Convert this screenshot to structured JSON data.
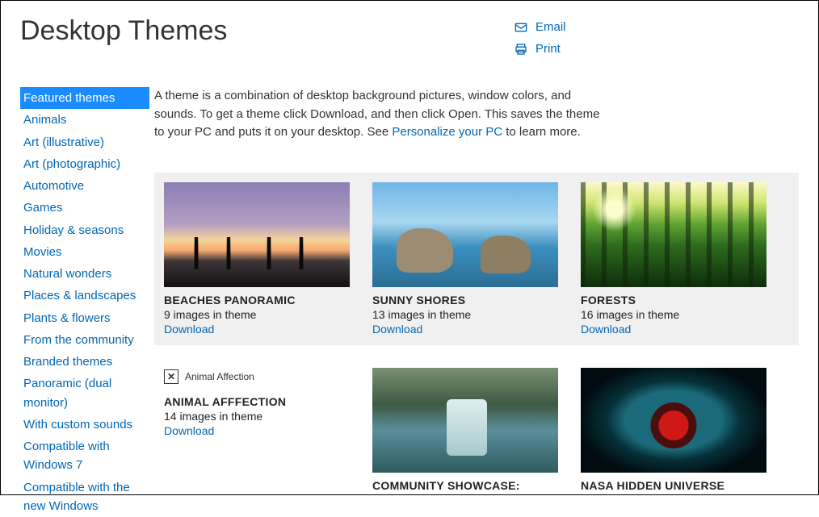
{
  "page_title": "Desktop Themes",
  "share": {
    "email": "Email",
    "print": "Print"
  },
  "intro": {
    "pre": "A theme is a combination of desktop background pictures, window colors, and sounds. To get a theme click Download, and then click Open. This saves the theme to your PC and puts it on your desktop. See ",
    "link": "Personalize your PC",
    "post": " to learn more."
  },
  "sidebar": {
    "items": [
      "Featured themes",
      "Animals",
      "Art (illustrative)",
      "Art (photographic)",
      "Automotive",
      "Games",
      "Holiday & seasons",
      "Movies",
      "Natural wonders",
      "Places & landscapes",
      "Plants & flowers",
      "From the community",
      "Branded themes",
      "Panoramic (dual monitor)",
      "With custom sounds",
      "Compatible with Windows 7",
      "Compatible with the new Windows"
    ],
    "active_index": 0
  },
  "download_label": "Download",
  "row1": [
    {
      "title": "BEACHES PANORAMIC",
      "sub": "9 images in theme"
    },
    {
      "title": "SUNNY SHORES",
      "sub": "13 images in theme"
    },
    {
      "title": "FORESTS",
      "sub": "16 images in theme"
    }
  ],
  "row2": [
    {
      "alt": "Animal Affection",
      "title": "ANIMAL AFFFECTION",
      "sub": "14 images in theme"
    },
    {
      "title": "COMMUNITY SHOWCASE:"
    },
    {
      "title": "NASA HIDDEN UNIVERSE"
    }
  ]
}
